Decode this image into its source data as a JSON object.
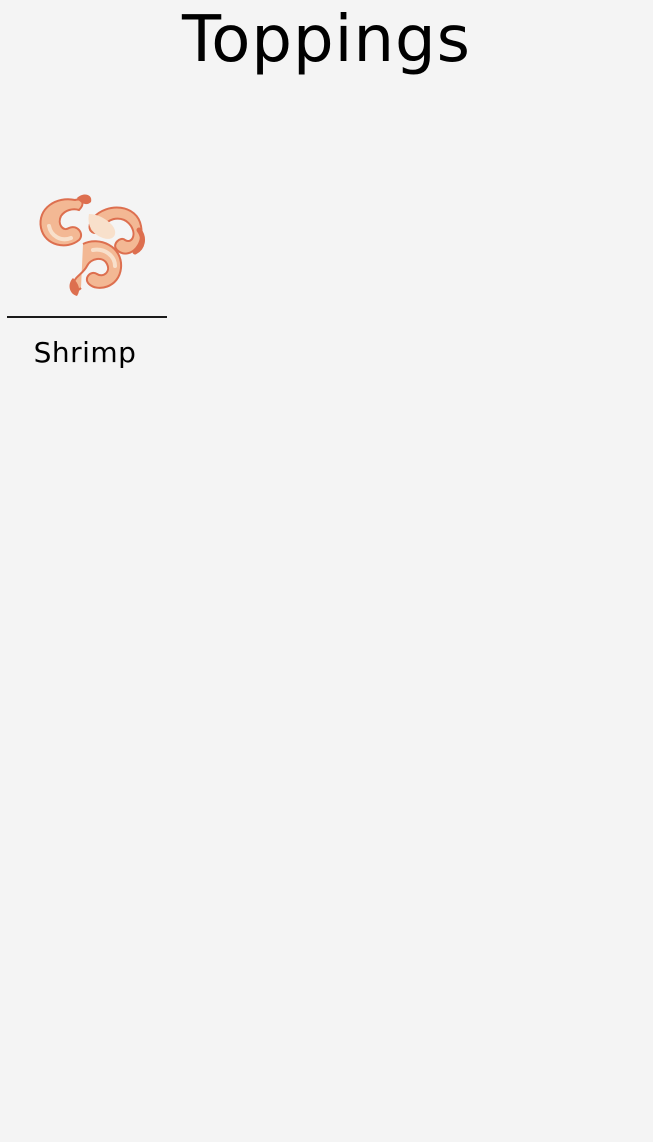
{
  "page": {
    "title": "Toppings"
  },
  "toppings": [
    {
      "label": "Shrimp",
      "icon": "shrimp-icon"
    }
  ],
  "colors": {
    "background": "#f4f4f4",
    "text": "#000000",
    "shrimp_body": "#f3b894",
    "shrimp_light": "#f8e0cb",
    "shrimp_dark": "#dd6f4f"
  }
}
